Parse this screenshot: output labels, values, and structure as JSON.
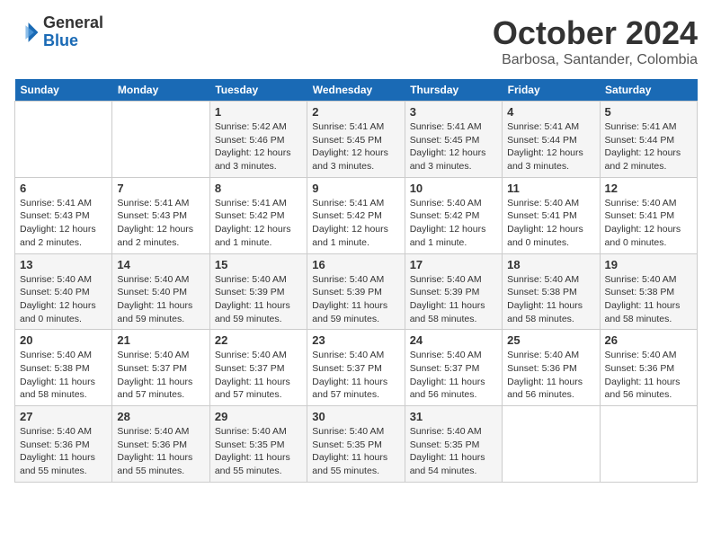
{
  "logo": {
    "line1": "General",
    "line2": "Blue"
  },
  "title": "October 2024",
  "subtitle": "Barbosa, Santander, Colombia",
  "weekdays": [
    "Sunday",
    "Monday",
    "Tuesday",
    "Wednesday",
    "Thursday",
    "Friday",
    "Saturday"
  ],
  "weeks": [
    [
      {
        "day": "",
        "info": ""
      },
      {
        "day": "",
        "info": ""
      },
      {
        "day": "1",
        "info": "Sunrise: 5:42 AM\nSunset: 5:46 PM\nDaylight: 12 hours and 3 minutes."
      },
      {
        "day": "2",
        "info": "Sunrise: 5:41 AM\nSunset: 5:45 PM\nDaylight: 12 hours and 3 minutes."
      },
      {
        "day": "3",
        "info": "Sunrise: 5:41 AM\nSunset: 5:45 PM\nDaylight: 12 hours and 3 minutes."
      },
      {
        "day": "4",
        "info": "Sunrise: 5:41 AM\nSunset: 5:44 PM\nDaylight: 12 hours and 3 minutes."
      },
      {
        "day": "5",
        "info": "Sunrise: 5:41 AM\nSunset: 5:44 PM\nDaylight: 12 hours and 2 minutes."
      }
    ],
    [
      {
        "day": "6",
        "info": "Sunrise: 5:41 AM\nSunset: 5:43 PM\nDaylight: 12 hours and 2 minutes."
      },
      {
        "day": "7",
        "info": "Sunrise: 5:41 AM\nSunset: 5:43 PM\nDaylight: 12 hours and 2 minutes."
      },
      {
        "day": "8",
        "info": "Sunrise: 5:41 AM\nSunset: 5:42 PM\nDaylight: 12 hours and 1 minute."
      },
      {
        "day": "9",
        "info": "Sunrise: 5:41 AM\nSunset: 5:42 PM\nDaylight: 12 hours and 1 minute."
      },
      {
        "day": "10",
        "info": "Sunrise: 5:40 AM\nSunset: 5:42 PM\nDaylight: 12 hours and 1 minute."
      },
      {
        "day": "11",
        "info": "Sunrise: 5:40 AM\nSunset: 5:41 PM\nDaylight: 12 hours and 0 minutes."
      },
      {
        "day": "12",
        "info": "Sunrise: 5:40 AM\nSunset: 5:41 PM\nDaylight: 12 hours and 0 minutes."
      }
    ],
    [
      {
        "day": "13",
        "info": "Sunrise: 5:40 AM\nSunset: 5:40 PM\nDaylight: 12 hours and 0 minutes."
      },
      {
        "day": "14",
        "info": "Sunrise: 5:40 AM\nSunset: 5:40 PM\nDaylight: 11 hours and 59 minutes."
      },
      {
        "day": "15",
        "info": "Sunrise: 5:40 AM\nSunset: 5:39 PM\nDaylight: 11 hours and 59 minutes."
      },
      {
        "day": "16",
        "info": "Sunrise: 5:40 AM\nSunset: 5:39 PM\nDaylight: 11 hours and 59 minutes."
      },
      {
        "day": "17",
        "info": "Sunrise: 5:40 AM\nSunset: 5:39 PM\nDaylight: 11 hours and 58 minutes."
      },
      {
        "day": "18",
        "info": "Sunrise: 5:40 AM\nSunset: 5:38 PM\nDaylight: 11 hours and 58 minutes."
      },
      {
        "day": "19",
        "info": "Sunrise: 5:40 AM\nSunset: 5:38 PM\nDaylight: 11 hours and 58 minutes."
      }
    ],
    [
      {
        "day": "20",
        "info": "Sunrise: 5:40 AM\nSunset: 5:38 PM\nDaylight: 11 hours and 58 minutes."
      },
      {
        "day": "21",
        "info": "Sunrise: 5:40 AM\nSunset: 5:37 PM\nDaylight: 11 hours and 57 minutes."
      },
      {
        "day": "22",
        "info": "Sunrise: 5:40 AM\nSunset: 5:37 PM\nDaylight: 11 hours and 57 minutes."
      },
      {
        "day": "23",
        "info": "Sunrise: 5:40 AM\nSunset: 5:37 PM\nDaylight: 11 hours and 57 minutes."
      },
      {
        "day": "24",
        "info": "Sunrise: 5:40 AM\nSunset: 5:37 PM\nDaylight: 11 hours and 56 minutes."
      },
      {
        "day": "25",
        "info": "Sunrise: 5:40 AM\nSunset: 5:36 PM\nDaylight: 11 hours and 56 minutes."
      },
      {
        "day": "26",
        "info": "Sunrise: 5:40 AM\nSunset: 5:36 PM\nDaylight: 11 hours and 56 minutes."
      }
    ],
    [
      {
        "day": "27",
        "info": "Sunrise: 5:40 AM\nSunset: 5:36 PM\nDaylight: 11 hours and 55 minutes."
      },
      {
        "day": "28",
        "info": "Sunrise: 5:40 AM\nSunset: 5:36 PM\nDaylight: 11 hours and 55 minutes."
      },
      {
        "day": "29",
        "info": "Sunrise: 5:40 AM\nSunset: 5:35 PM\nDaylight: 11 hours and 55 minutes."
      },
      {
        "day": "30",
        "info": "Sunrise: 5:40 AM\nSunset: 5:35 PM\nDaylight: 11 hours and 55 minutes."
      },
      {
        "day": "31",
        "info": "Sunrise: 5:40 AM\nSunset: 5:35 PM\nDaylight: 11 hours and 54 minutes."
      },
      {
        "day": "",
        "info": ""
      },
      {
        "day": "",
        "info": ""
      }
    ]
  ]
}
